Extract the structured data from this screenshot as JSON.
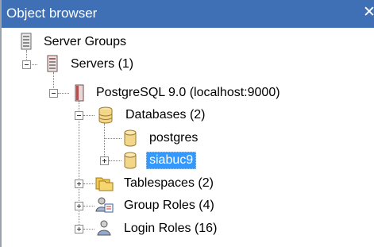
{
  "panel": {
    "title": "Object browser",
    "close_glyph": "✕"
  },
  "tree": {
    "server_groups": {
      "label": "Server Groups",
      "icon": "server-groups-icon"
    },
    "servers": {
      "label": "Servers (1)",
      "icon": "servers-icon",
      "expanded": true
    },
    "postgres_server": {
      "label": "PostgreSQL 9.0 (localhost:9000)",
      "icon": "postgresql-server-icon",
      "expanded": true
    },
    "databases": {
      "label": "Databases (2)",
      "icon": "databases-icon",
      "expanded": true
    },
    "db_postgres": {
      "label": "postgres",
      "icon": "database-icon"
    },
    "db_siabuc9": {
      "label": "siabuc9",
      "icon": "database-icon",
      "selected": true,
      "expanded": false
    },
    "tablespaces": {
      "label": "Tablespaces (2)",
      "icon": "tablespaces-icon",
      "expanded": false
    },
    "group_roles": {
      "label": "Group Roles (4)",
      "icon": "group-roles-icon",
      "expanded": false
    },
    "login_roles": {
      "label": "Login Roles (16)",
      "icon": "login-roles-icon",
      "expanded": false
    }
  },
  "colors": {
    "titlebar": "#3f6fb4",
    "selection": "#3399ff",
    "db_icon": "#f2d68a"
  }
}
